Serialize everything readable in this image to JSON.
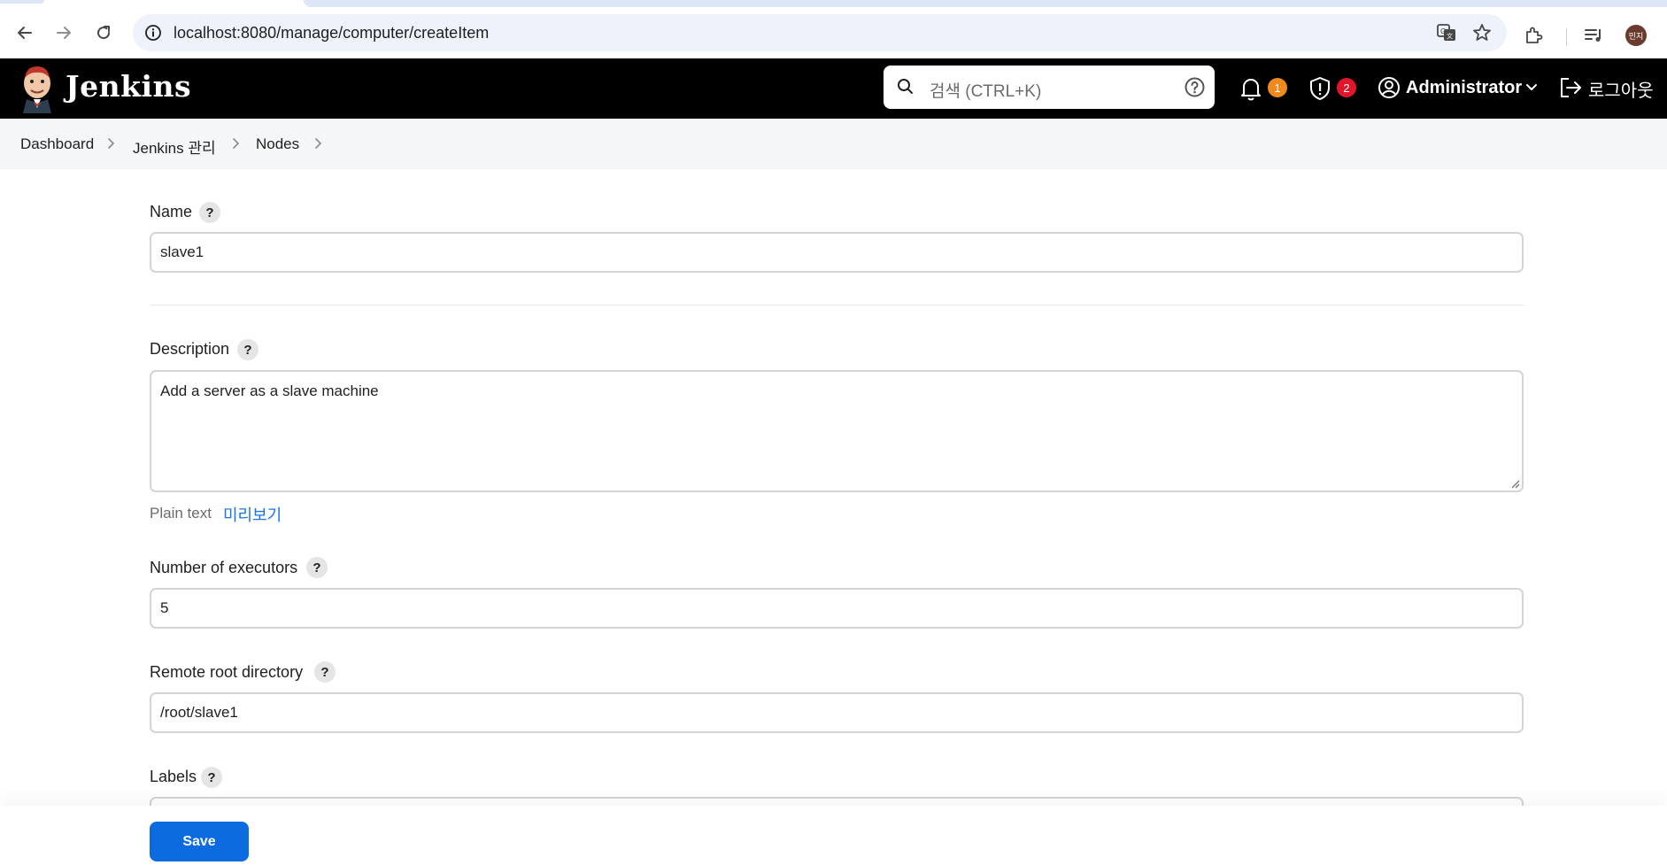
{
  "browser": {
    "url": "localhost:8080/manage/computer/createItem",
    "profile_initials": "민지"
  },
  "header": {
    "brand": "Jenkins",
    "search_placeholder": "검색 (CTRL+K)",
    "notifications_count": "1",
    "security_count": "2",
    "user": "Administrator",
    "logout": "로그아웃"
  },
  "breadcrumb": {
    "items": [
      "Dashboard",
      "Jenkins 관리",
      "Nodes"
    ]
  },
  "form": {
    "name_label": "Name",
    "name_value": "slave1",
    "description_label": "Description",
    "description_value": "Add a server as a slave machine",
    "plain_text": "Plain text",
    "preview_link": "미리보기",
    "executors_label": "Number of executors",
    "executors_value": "5",
    "remote_root_label": "Remote root directory",
    "remote_root_value": "/root/slave1",
    "labels_label": "Labels",
    "help_mark": "?"
  },
  "actions": {
    "save": "Save"
  }
}
